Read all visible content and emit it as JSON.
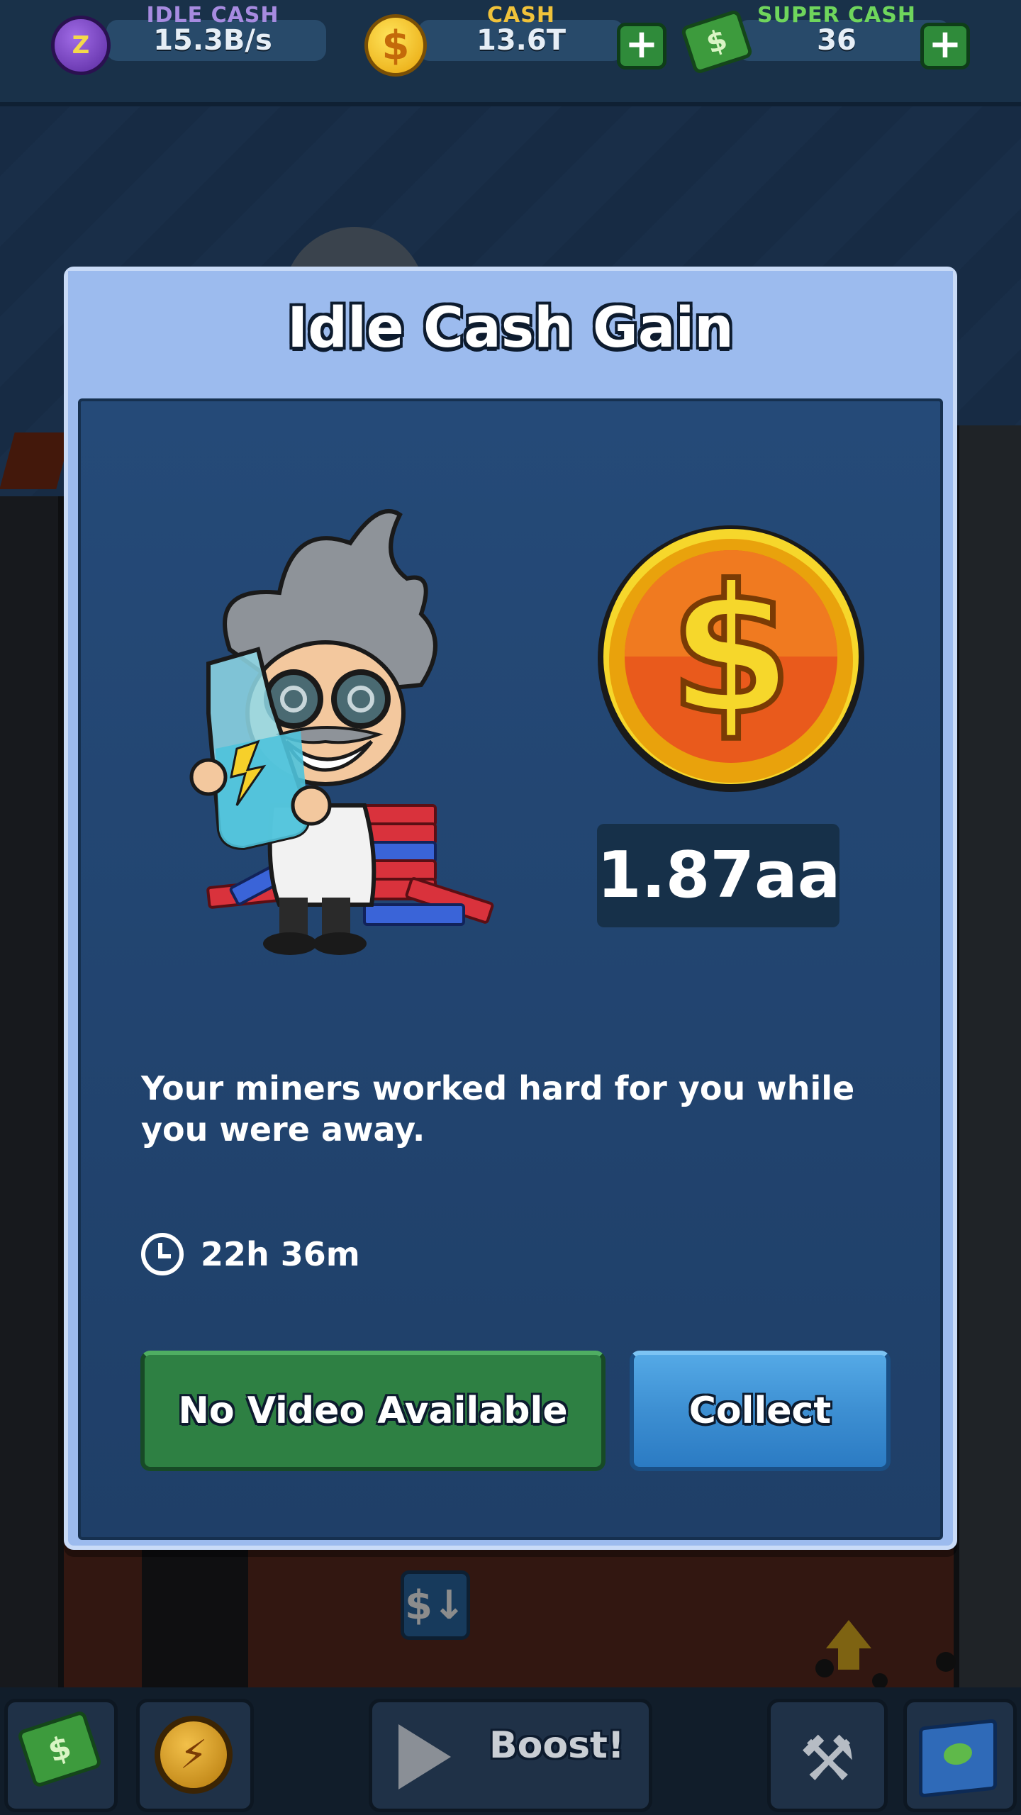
{
  "topbar": {
    "idle_cash": {
      "label": "IDLE CASH",
      "value": "15.3B/s",
      "icon": "zzz-clock-icon"
    },
    "cash": {
      "label": "CASH",
      "value": "13.6T",
      "icon": "dollar-coin-icon",
      "plus": "+"
    },
    "super_cash": {
      "label": "SUPER CASH",
      "value": "36",
      "icon": "cash-stack-icon",
      "plus": "+"
    },
    "colors": {
      "idle_label": "#a78be0",
      "cash_label": "#f0c23a",
      "super_label": "#6fd55c"
    }
  },
  "modal": {
    "title": "Idle Cash Gain",
    "reward_amount": "1.87aa",
    "message": "Your miners worked hard for you while you were away.",
    "time_away": "22h 36m",
    "buttons": {
      "video_label": "No Video Available",
      "collect_label": "Collect"
    }
  },
  "bottombar": {
    "boost_label": "Boost!",
    "icons": [
      "cash-stack-icon",
      "boost-coin-icon",
      "play-icon",
      "pickaxe-shovel-icon",
      "map-icon"
    ]
  },
  "background": {
    "withdraw_icon": "$↓"
  }
}
